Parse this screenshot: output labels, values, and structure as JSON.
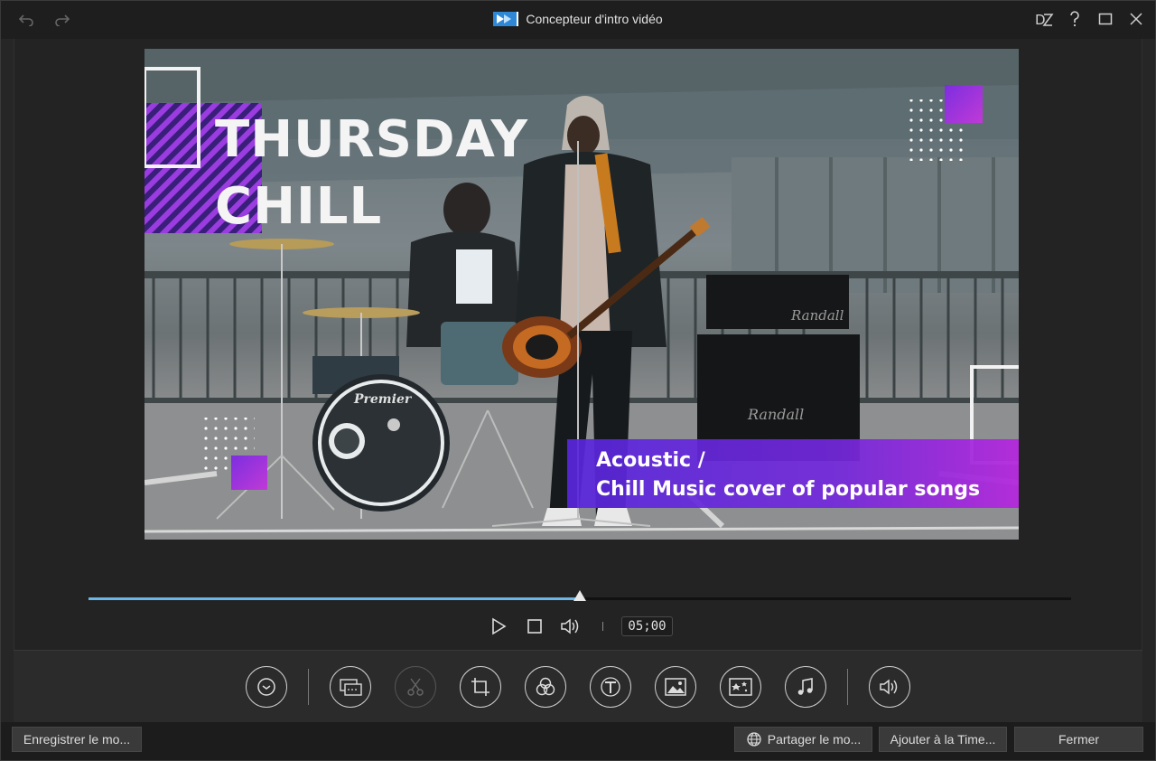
{
  "window": {
    "title": "Concepteur d'intro vidéo"
  },
  "titlebar": {
    "undo_icon": "undo-arrow-icon",
    "redo_icon": "redo-arrow-icon",
    "right_icons": [
      "dz-skin-icon",
      "help-icon",
      "maximize-icon",
      "close-icon"
    ]
  },
  "preview": {
    "title_lines": [
      "THURSDAY",
      "CHILL"
    ],
    "subtitle_lines": [
      "Acoustic /",
      "Chill Music cover of popular songs"
    ],
    "accent_purple": "#7c2ee0",
    "accent_magenta": "#b43ad8"
  },
  "playback": {
    "progress": 0.5,
    "timecode": "05;00",
    "accent": "#6ab7e6"
  },
  "tools": [
    "timer-icon",
    "replace-media-icon",
    "scissors-icon",
    "crop-icon",
    "color-circles-icon",
    "text-icon",
    "image-icon",
    "particle-icon",
    "music-note-icon",
    "volume-icon"
  ],
  "footer": {
    "save_template": "Enregistrer le mo...",
    "share_template": "Partager le mo...",
    "add_to_timeline": "Ajouter à la Time...",
    "close": "Fermer"
  }
}
